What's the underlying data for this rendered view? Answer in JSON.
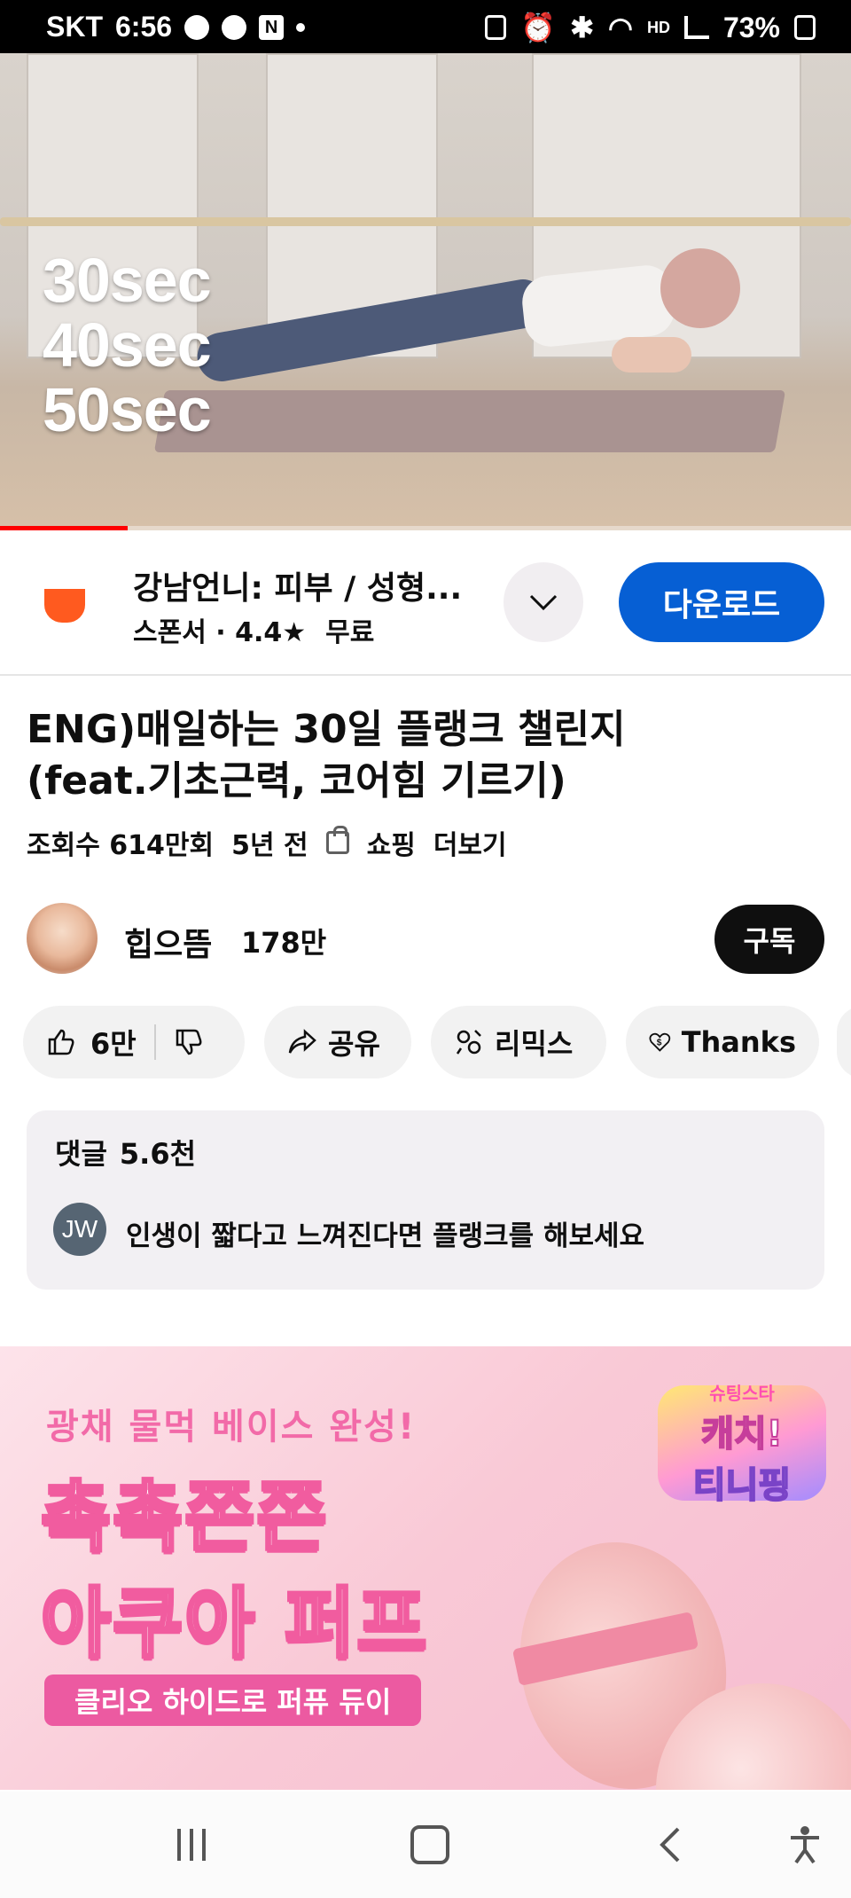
{
  "status_bar": {
    "carrier": "SKT",
    "time": "6:56",
    "notification_badge": "N",
    "voice_badge": "HD",
    "battery": "73%"
  },
  "video": {
    "overlay_lines": [
      "30sec",
      "40sec",
      "50sec"
    ],
    "progress_fraction": 0.15
  },
  "ad": {
    "app_name": "강남언니: 피부 / 성형...",
    "sponsor_label": "스폰서 · 4.4★",
    "price": "무료",
    "cta_label": "다운로드",
    "logo_color": "#ff5a1f"
  },
  "video_info": {
    "title_line1": "ENG)매일하는 30일 플랭크 챌린지",
    "title_line2": "(feat.기초근력, 코어힘 기르기)",
    "views": "조회수 614만회",
    "age": "5년 전",
    "shopping_label": "쇼핑",
    "more_label": "더보기"
  },
  "channel": {
    "name": "힙으뜸",
    "subscribers": "178만",
    "subscribe_label": "구독"
  },
  "actions": {
    "like_count": "6만",
    "share_label": "공유",
    "remix_label": "리믹스",
    "thanks_label": "Thanks"
  },
  "comments": {
    "label": "댓글",
    "count": "5.6천",
    "top_author_initials": "JW",
    "top_comment": "인생이 짧다고 느껴진다면 플랭크를 해보세요"
  },
  "promo": {
    "tagline": "광채 물먹 베이스 완성!",
    "headline1": "촉촉쫀쫀",
    "headline2": "아쿠아 퍼프",
    "badge": "클리오 하이드로 퍼퓨 듀이",
    "logo_top": "슈팅스타",
    "logo_mid": "캐치!",
    "logo_bottom": "티니핑"
  },
  "accent_colors": {
    "cta_blue": "#065fd4",
    "promo_pink": "#ec5aa1"
  }
}
